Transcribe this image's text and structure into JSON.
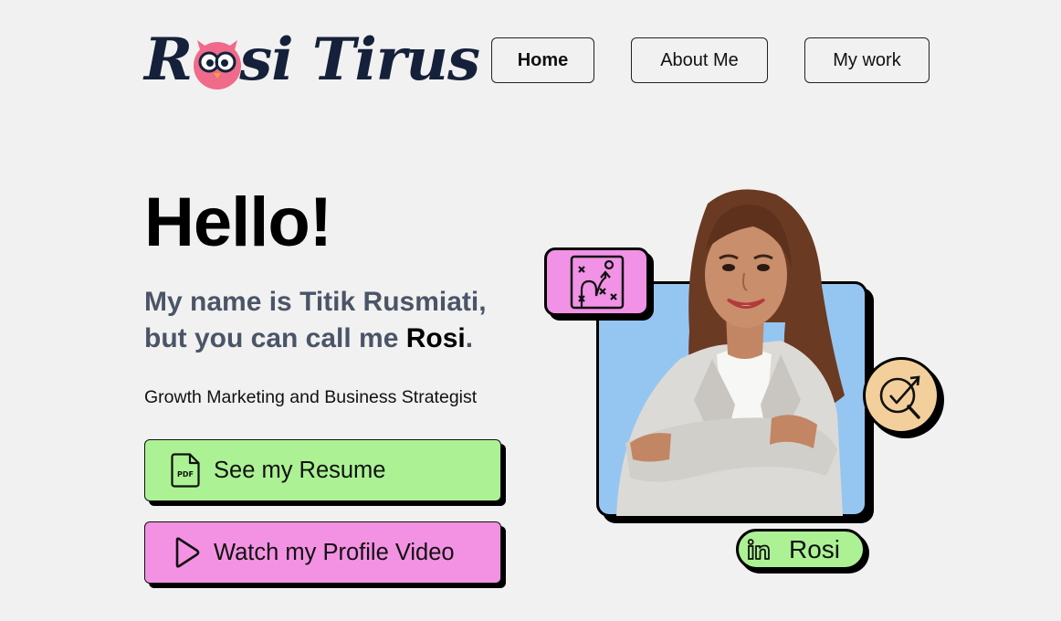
{
  "logo": {
    "text_part1": "R",
    "text_part2": "si Tirus",
    "icon": "owl-mascot-icon"
  },
  "nav": {
    "items": [
      {
        "label": "Home",
        "active": true
      },
      {
        "label": "About Me",
        "active": false
      },
      {
        "label": "My work",
        "active": false
      }
    ]
  },
  "hero": {
    "greeting": "Hello!",
    "intro_line1": "My name is Titik Rusmiati,",
    "intro_line2_prefix": "but you can call me ",
    "intro_nickname": "Rosi",
    "intro_line2_suffix": ".",
    "role": "Growth Marketing and Business Strategist"
  },
  "cta": {
    "resume_label": "See my Resume",
    "resume_icon": "pdf-file-icon",
    "video_label": "Watch my Profile Video",
    "video_icon": "play-icon"
  },
  "portrait": {
    "badges": [
      "strategy-board-icon",
      "growth-target-icon"
    ],
    "linkedin_name": "Rosi",
    "linkedin_icon": "linkedin-icon"
  },
  "colors": {
    "background": "#f2f1f1",
    "green": "#acf294",
    "pink": "#f392e3",
    "blue": "#95c6f1",
    "peach": "#f3cf9c",
    "intro_text": "#4a5567",
    "logo_navy": "#15213a"
  }
}
